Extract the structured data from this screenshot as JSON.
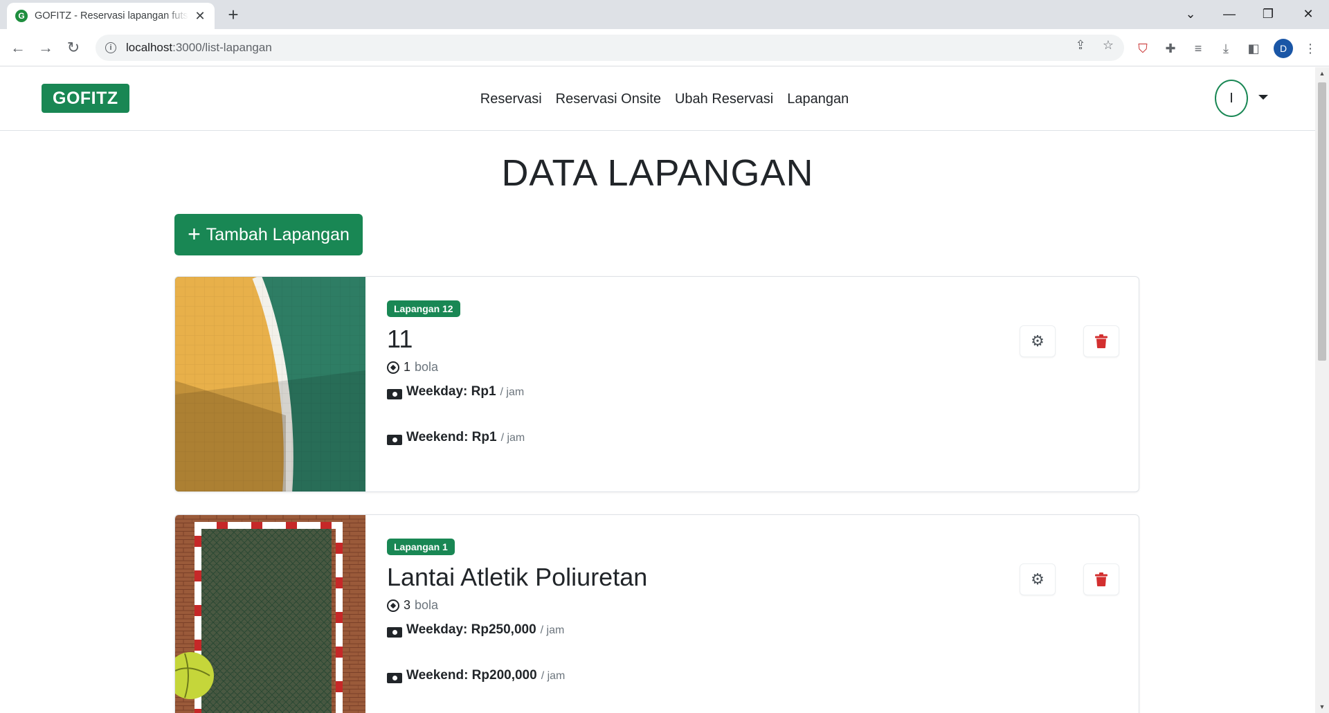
{
  "browser": {
    "tab_title": "GOFITZ - Reservasi lapangan futsal",
    "favicon_letter": "G",
    "new_tab_symbol": "+",
    "url_host": "localhost",
    "url_path": ":3000/list-lapangan",
    "profile_initial": "D"
  },
  "navbar": {
    "brand": "GOFITZ",
    "menu": [
      "Reservasi",
      "Reservasi Onsite",
      "Ubah Reservasi",
      "Lapangan"
    ],
    "user_initial": "I"
  },
  "page": {
    "title": "DATA LAPANGAN",
    "add_button_icon": "+",
    "add_button_label": "Tambah Lapangan"
  },
  "cards": [
    {
      "badge": "Lapangan 12",
      "name": "11",
      "balls_count": "1",
      "balls_unit": "bola",
      "weekday_label": "Weekday: Rp1",
      "weekend_label": "Weekend: Rp1",
      "per_unit": "/ jam"
    },
    {
      "badge": "Lapangan 1",
      "name": "Lantai Atletik Poliuretan",
      "balls_count": "3",
      "balls_unit": "bola",
      "weekday_label": "Weekday: Rp250,000",
      "weekend_label": "Weekend: Rp200,000",
      "per_unit": "/ jam"
    }
  ],
  "colors": {
    "primary_green": "#198754",
    "danger_red": "#d32f2f",
    "court_orange": "#e8b04a",
    "court_green": "#2e7d64"
  }
}
